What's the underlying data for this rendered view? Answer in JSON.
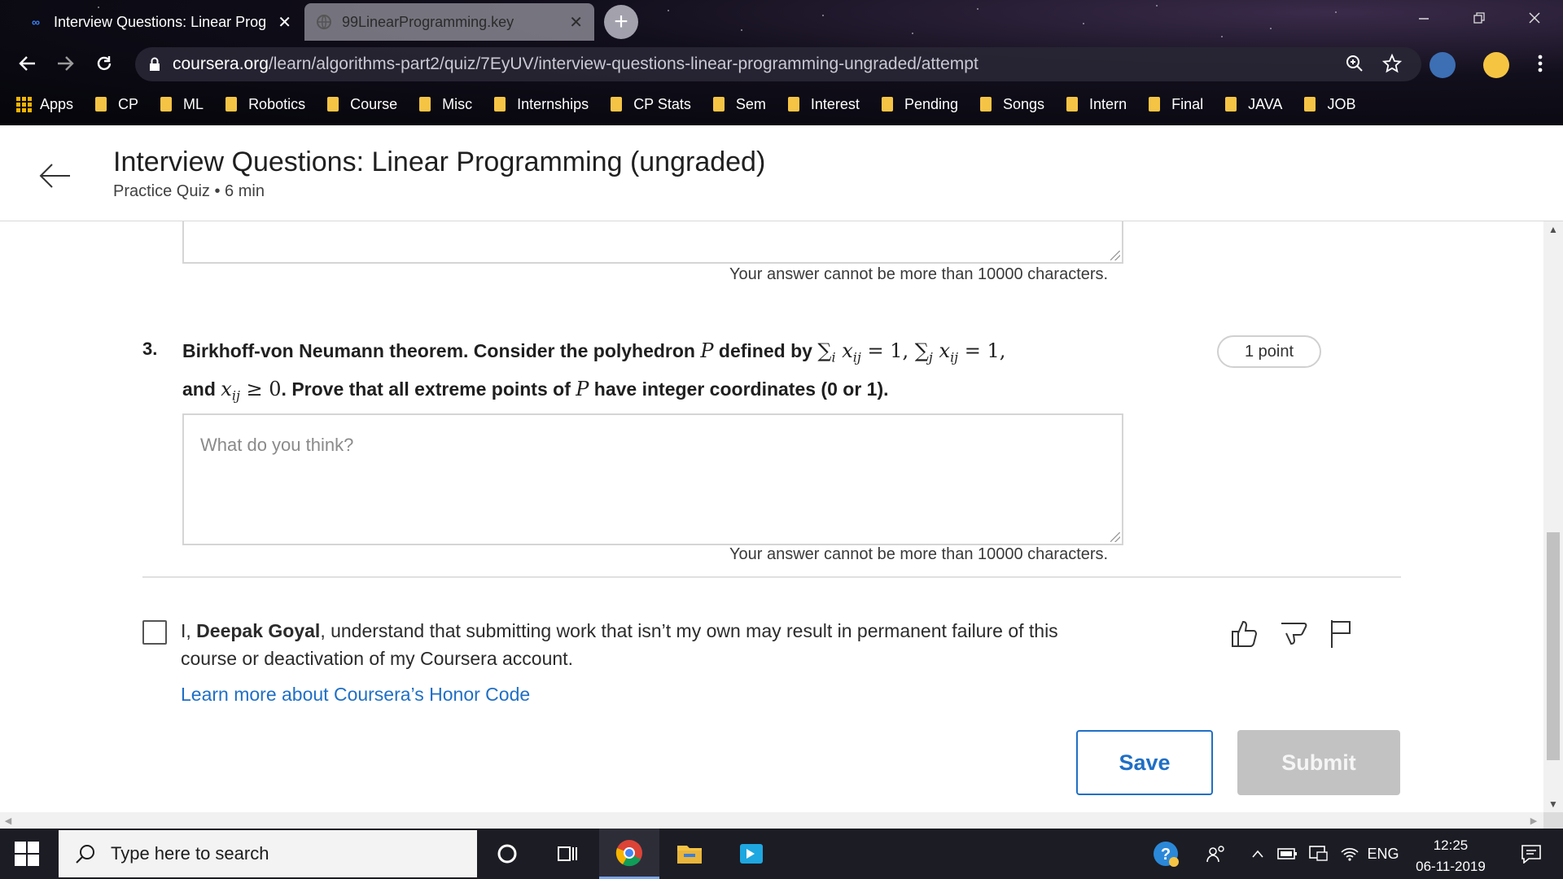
{
  "browser": {
    "tabs": [
      {
        "title": "Interview Questions: Linear Prog",
        "close": "✕",
        "active": true
      },
      {
        "title": "99LinearProgramming.key",
        "close": "✕",
        "active": false
      }
    ],
    "new_tab": "+",
    "url_host": "coursera.org",
    "url_path": "/learn/algorithms-part2/quiz/7EyUV/interview-questions-linear-programming-ungraded/attempt",
    "bookmarks": [
      "Apps",
      "CP",
      "ML",
      "Robotics",
      "Course",
      "Misc",
      "Internships",
      "CP Stats",
      "Sem",
      "Interest",
      "Pending",
      "Songs",
      "Intern",
      "Final",
      "JAVA",
      "JOB"
    ]
  },
  "header": {
    "title": "Interview Questions: Linear Programming (ungraded)",
    "subtitle": "Practice Quiz • 6 min"
  },
  "prev_answer": {
    "char_limit": "Your answer cannot be more than 10000 characters."
  },
  "question": {
    "number": "3.",
    "text_a": "Birkhoff-von Neumann theorem. Consider the polyhedron ",
    "P": "P",
    "text_b": " defined by ",
    "sum_i": "∑",
    "sub_i": "i",
    "x_ij_1": "x",
    "ij_1": "ij",
    "eq_1": " = 1, ",
    "sum_j": "∑",
    "sub_j": "j",
    "x_ij_2": "x",
    "ij_2": "ij",
    "eq_2": " = 1,",
    "text_c": "and ",
    "x_ij_3": "x",
    "ij_3": "ij",
    "geq": " ≥ 0",
    "text_d": ". Prove that all extreme points of ",
    "P2": "P",
    "text_e": " have integer coordinates (0 or 1).",
    "points": "1 point",
    "placeholder": "What do you think?",
    "char_limit": "Your answer cannot be more than 10000 characters."
  },
  "honor": {
    "prefix": "I, ",
    "name": "Deepak Goyal",
    "suffix": ", understand that submitting work that isn’t my own may result in permanent failure of this course or deactivation of my Coursera account.",
    "link": "Learn more about Coursera’s Honor Code"
  },
  "actions": {
    "save": "Save",
    "submit": "Submit"
  },
  "taskbar": {
    "search_placeholder": "Type here to search",
    "language": "ENG",
    "time": "12:25",
    "date": "06-11-2019"
  },
  "colors": {
    "accent": "#1f6fc5",
    "submit_disabled": "#c2c2c2",
    "bookmark_folder": "#f6c445"
  }
}
